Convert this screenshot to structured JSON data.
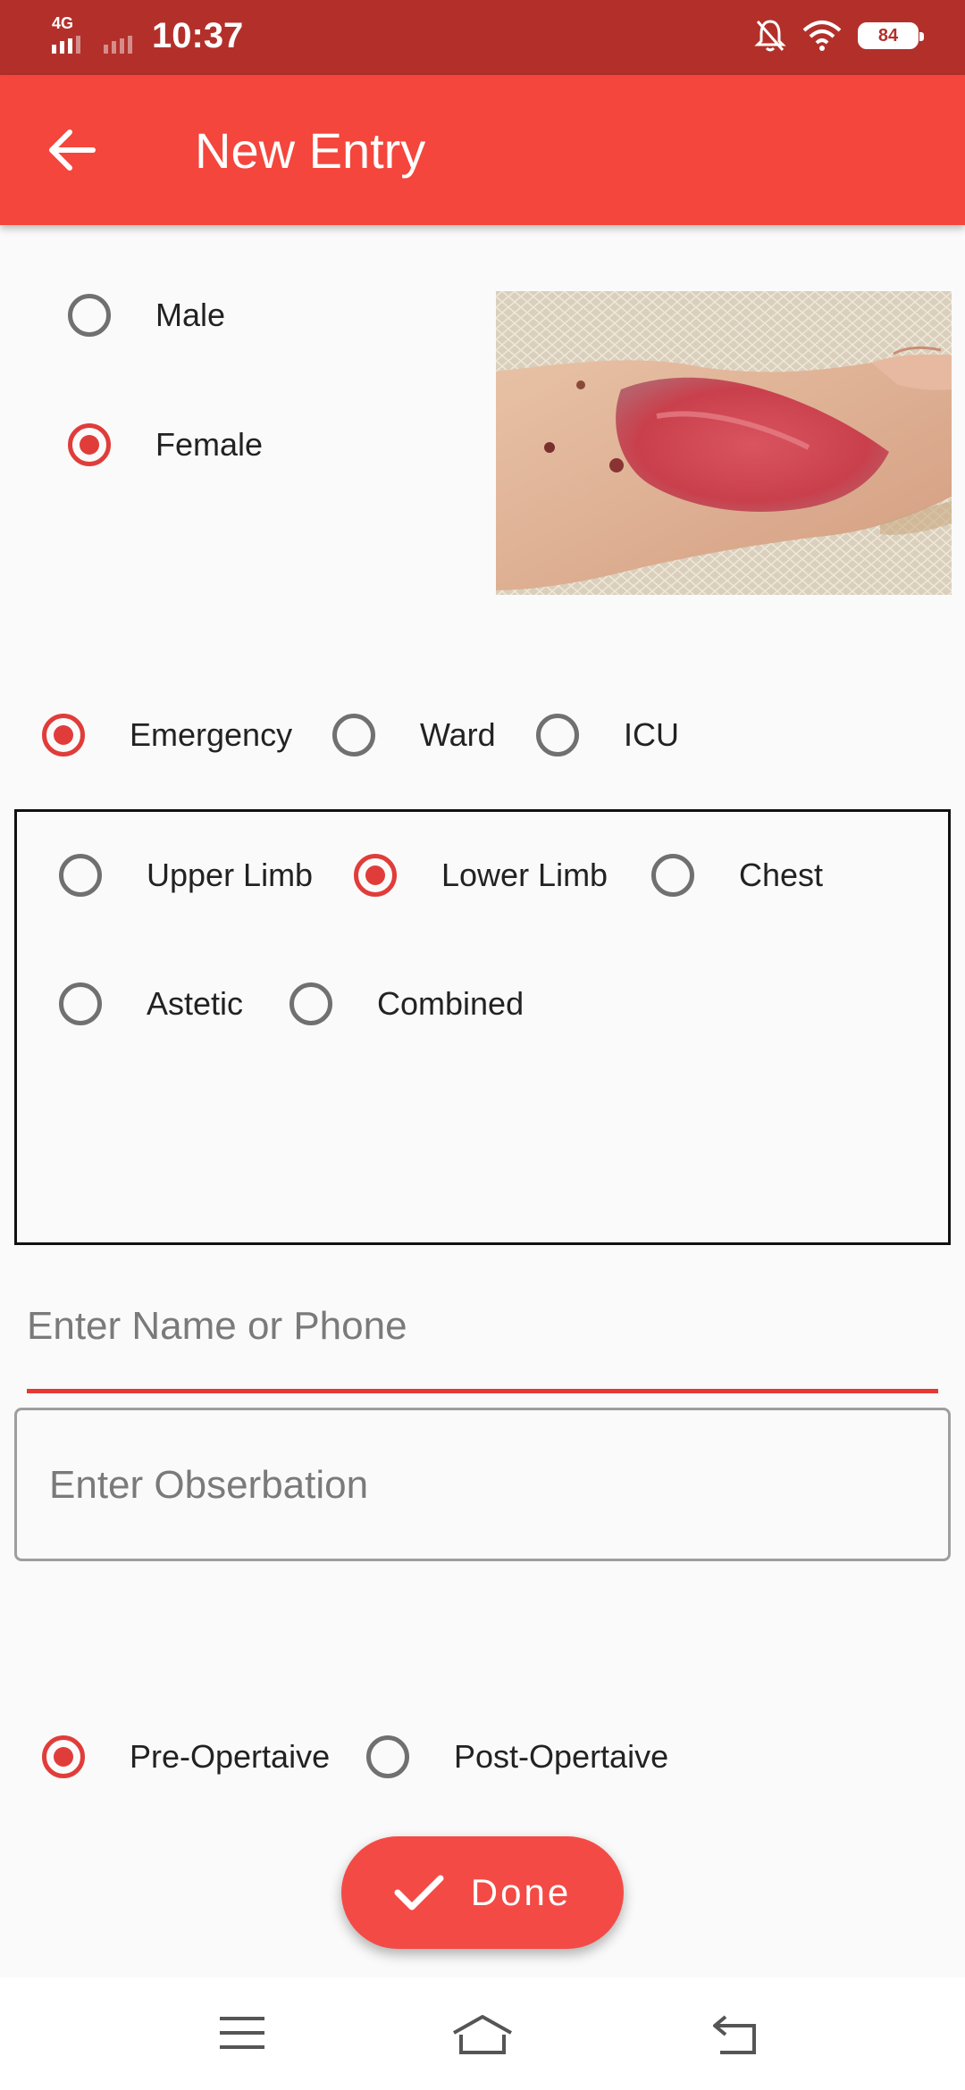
{
  "status_bar": {
    "network": "4G",
    "time": "10:37",
    "battery": "84",
    "icons": [
      "signal-icon",
      "mute-icon",
      "wifi-icon",
      "battery-icon"
    ]
  },
  "app_bar": {
    "title": "New Entry",
    "back_icon": "arrow-left-icon"
  },
  "gender": {
    "options": [
      {
        "label": "Male",
        "selected": false
      },
      {
        "label": "Female",
        "selected": true
      }
    ]
  },
  "photo": {
    "subject": "wound-photo"
  },
  "department": {
    "options": [
      {
        "label": "Emergency",
        "selected": true
      },
      {
        "label": "Ward",
        "selected": false
      },
      {
        "label": "ICU",
        "selected": false
      }
    ]
  },
  "body_region": {
    "options": [
      {
        "label": "Upper Limb",
        "selected": false
      },
      {
        "label": "Lower Limb",
        "selected": true
      },
      {
        "label": "Chest",
        "selected": false
      },
      {
        "label": "Astetic",
        "selected": false
      },
      {
        "label": "Combined",
        "selected": false
      }
    ]
  },
  "name_input": {
    "placeholder": "Enter Name or Phone",
    "value": ""
  },
  "observation_input": {
    "placeholder": "Enter Obserbation",
    "value": ""
  },
  "operative": {
    "options": [
      {
        "label": "Pre-Opertaive",
        "selected": true
      },
      {
        "label": "Post-Opertaive",
        "selected": false
      }
    ]
  },
  "done_button": {
    "label": "Done",
    "icon": "check-icon"
  },
  "nav_bar": {
    "icons": [
      "menu-icon",
      "home-icon",
      "back-icon"
    ]
  },
  "colors": {
    "status_bar": "#b3302a",
    "app_bar": "#f4463c",
    "accent": "#e03d3a",
    "fab": "#f44a45"
  }
}
